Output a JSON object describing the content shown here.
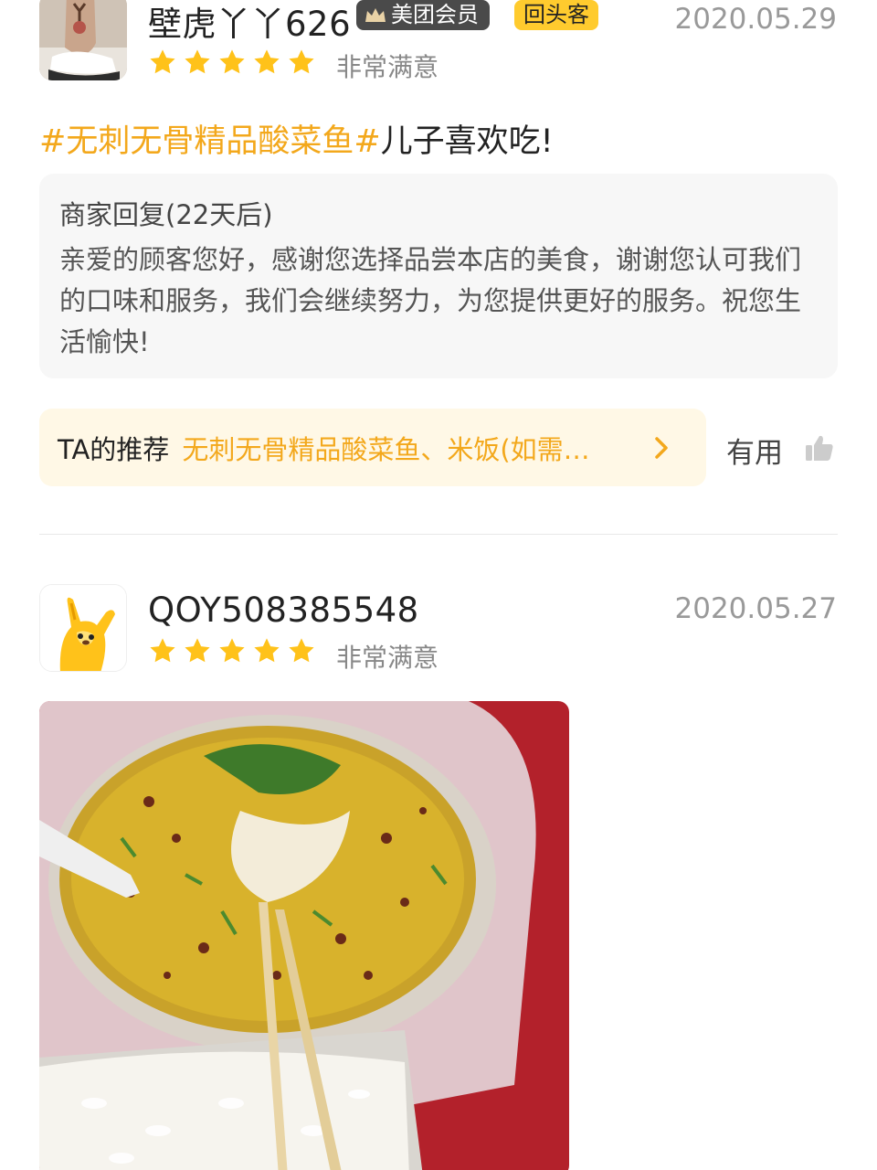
{
  "reviews": [
    {
      "username": "壁虎丫丫626",
      "badges": {
        "member": "美团会员",
        "return_customer": "回头客"
      },
      "date": "2020.05.29",
      "rating_stars": 5,
      "rating_text": "非常满意",
      "content": {
        "hashtag": "#无刺无骨精品酸菜鱼#",
        "text": "儿子喜欢吃!"
      },
      "merchant_reply": {
        "title": "商家回复(22天后)",
        "body": "亲爱的顾客您好，感谢您选择品尝本店的美食，谢谢您认可我们的口味和服务，我们会继续努力，为您提供更好的服务。祝您生活愉快!"
      },
      "recommend": {
        "label": "TA的推荐",
        "dishes": "无刺无骨精品酸菜鱼、米饭(如需…"
      },
      "helpful_label": "有用"
    },
    {
      "username": "QOY508385548",
      "date": "2020.05.27",
      "rating_stars": 5,
      "rating_text": "非常满意"
    }
  ],
  "colors": {
    "accent": "#f3a81c",
    "star": "#ffc21a",
    "badge_dark": "#4a4a4a",
    "badge_yellow": "#ffcb2e"
  },
  "icons": {
    "star": "star-icon",
    "chevron": "chevron-right-icon",
    "thumb": "thumbs-up-icon",
    "crown": "crown-icon"
  }
}
